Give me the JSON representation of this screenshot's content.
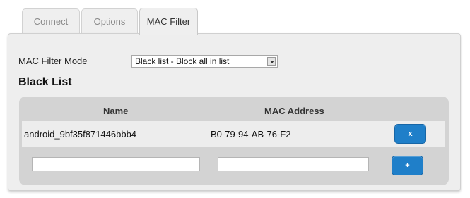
{
  "tabs": [
    {
      "label": "Connect"
    },
    {
      "label": "Options"
    },
    {
      "label": "MAC Filter"
    }
  ],
  "filter": {
    "mode_label": "MAC Filter Mode",
    "mode_value": "Black list - Block all in list"
  },
  "list": {
    "title": "Black List",
    "columns": {
      "name": "Name",
      "mac": "MAC Address"
    },
    "rows": [
      {
        "name": "android_9bf35f871446bbb4",
        "mac": "B0-79-94-AB-76-F2",
        "delete_label": "x"
      }
    ],
    "new_entry": {
      "name_value": "",
      "mac_value": "",
      "add_label": "+"
    }
  },
  "colors": {
    "accent": "#1f7fc9",
    "panel": "#eeeeee",
    "list_bg": "#d3d3d3"
  }
}
